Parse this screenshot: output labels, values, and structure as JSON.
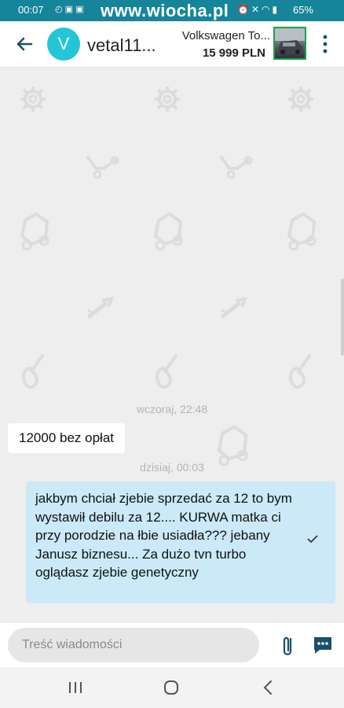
{
  "status_bar": {
    "time": "00:07",
    "watermark": "www.wiocha.pl",
    "battery": "65%"
  },
  "header": {
    "avatar_letter": "V",
    "username": "vetal11...",
    "ad_title": "Volkswagen To...",
    "ad_price": "15 999 PLN"
  },
  "chat": {
    "date_yesterday": "wczoraj, 22:48",
    "incoming_message": "12000 bez opłat",
    "date_today": "dzisiaj, 00:03",
    "outgoing_message": "jakbym chciał zjebie sprzedać za 12 to bym wystawił debilu za 12.... KURWA matka ci przy porodzie na łbie usiadła??? jebany Janusz biznesu... Za dużo tvn turbo oglądasz zjebie genetyczny"
  },
  "composer": {
    "placeholder": "Treść wiadomości"
  },
  "colors": {
    "status_bar": "#16859a",
    "avatar": "#23c6d6",
    "outgoing_bubble": "#cbe9f7",
    "accent": "#1a4f6e"
  }
}
